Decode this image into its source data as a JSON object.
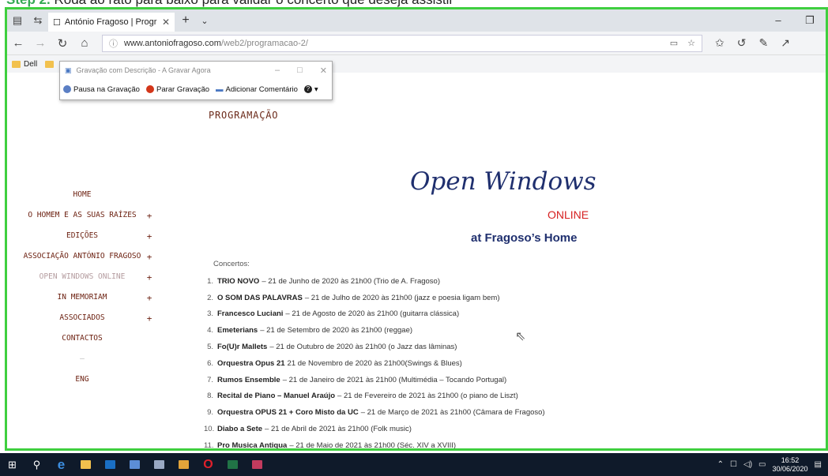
{
  "step_banner": {
    "prefix": "Step 2.",
    "text": " Rodá ao rato para baixo para validar o concerto que deseja assistir"
  },
  "browser": {
    "tab_title": "António Fragoso | Progr",
    "url_main": "www.antoniofragoso.com",
    "url_path": "/web2/programacao-2/",
    "favorites": [
      "Dell"
    ]
  },
  "recorder": {
    "title": "Gravação com Descrição - A Gravar Agora",
    "pause": "Pausa na Gravação",
    "stop": "Parar Gravação",
    "comment": "Adicionar Comentário",
    "help": "?"
  },
  "page": {
    "heading": "PROGRAMAÇÃO",
    "menu": [
      {
        "label": "HOME",
        "plus": ""
      },
      {
        "label": "O HOMEM E AS SUAS RAÍZES",
        "plus": "+"
      },
      {
        "label": "EDIÇÕES",
        "plus": "+"
      },
      {
        "label": "ASSOCIAÇÃO ANTÓNIO FRAGOSO",
        "plus": "+"
      },
      {
        "label": "OPEN WINDOWS ONLINE",
        "plus": "+"
      },
      {
        "label": "IN MEMORIAM",
        "plus": "+"
      },
      {
        "label": "ASSOCIADOS",
        "plus": "+"
      },
      {
        "label": "CONTACTOS",
        "plus": ""
      },
      {
        "label": "–",
        "plus": ""
      },
      {
        "label": "ENG",
        "plus": ""
      }
    ],
    "open_windows": {
      "title": "Open Windows",
      "online": "ONLINE",
      "home": "at Fragoso’s Home"
    },
    "concerts_title": "Concertos:",
    "concerts": [
      {
        "n": "1.",
        "name": "TRIO NOVO",
        "rest": "– 21 de Junho de 2020 às 21h00 (Trio de A. Fragoso)"
      },
      {
        "n": "2.",
        "name": "O SOM DAS PALAVRAS",
        "rest": "– 21 de Julho de 2020 às 21h00 (jazz e poesia ligam bem)"
      },
      {
        "n": "3.",
        "name": "Francesco Luciani",
        "rest": "– 21 de Agosto de 2020 às 21h00 (guitarra clássica)"
      },
      {
        "n": "4.",
        "name": "Emeterians",
        "rest": "– 21 de Setembro de 2020 às 21h00 (reggae)"
      },
      {
        "n": "5.",
        "name": "Fo(U)r Mallets",
        "rest": "– 21 de Outubro de 2020 às 21h00 (o Jazz das lâminas)"
      },
      {
        "n": "6.",
        "name": "Orquestra Opus 21",
        "rest": "21 de Novembro de 2020 às 21h00(Swings & Blues)"
      },
      {
        "n": "7.",
        "name": "Rumos Ensemble",
        "rest": "– 21 de Janeiro de 2021 às 21h00 (Multimédia – Tocando Portugal)"
      },
      {
        "n": "8.",
        "name": "Recital de Piano – Manuel Araújo",
        "rest": "– 21 de Fevereiro de 2021 às 21h00 (o piano de Liszt)"
      },
      {
        "n": "9.",
        "name": "Orquestra OPUS 21 + Coro Misto da UC",
        "rest": "– 21 de Março de 2021 às 21h00 (Câmara de Fragoso)"
      },
      {
        "n": "10.",
        "name": "Diabo a Sete",
        "rest": "– 21 de Abril de 2021 às 21h00 (Folk music)"
      },
      {
        "n": "11.",
        "name": "Pro Musica Antiqua",
        "rest": "– 21 de Maio de 2021 às 21h00 (Séc. XIV a XVIII)"
      }
    ]
  },
  "taskbar": {
    "time": "16:52",
    "date": "30/06/2020"
  },
  "colors": {
    "frame": "#3fcf3f",
    "menu": "#6b1f0f",
    "brand_blue": "#1f2f6e",
    "online_red": "#d62020"
  }
}
